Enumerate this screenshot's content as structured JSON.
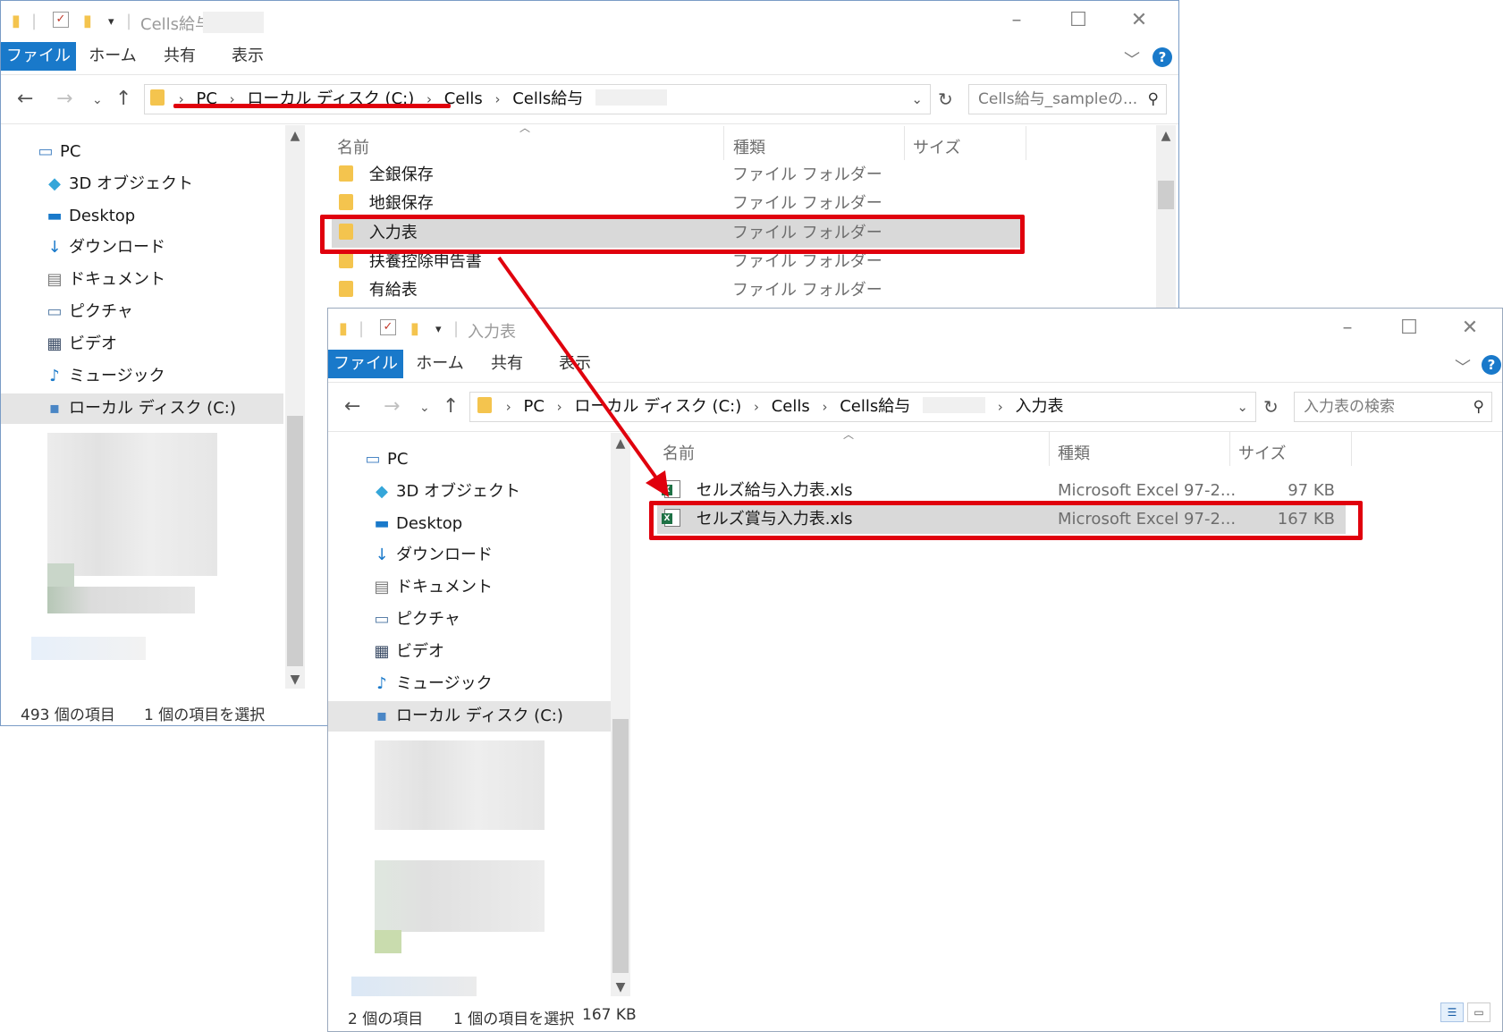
{
  "back_window": {
    "title": "Cells給与",
    "ribbon_tabs": [
      "ファイル",
      "ホーム",
      "共有",
      "表示"
    ],
    "breadcrumb": [
      "PC",
      "ローカル ディスク (C:)",
      "Cells",
      "Cells給与"
    ],
    "search_placeholder": "Cells給与_sampleの...",
    "columns": {
      "name": "名前",
      "type": "種類",
      "size": "サイズ"
    },
    "nav_items": [
      {
        "label": "PC",
        "icon": "pc-icon"
      },
      {
        "label": "3D オブジェクト",
        "icon": "3d-objects-icon"
      },
      {
        "label": "Desktop",
        "icon": "desktop-icon"
      },
      {
        "label": "ダウンロード",
        "icon": "download-icon"
      },
      {
        "label": "ドキュメント",
        "icon": "document-icon"
      },
      {
        "label": "ピクチャ",
        "icon": "picture-icon"
      },
      {
        "label": "ビデオ",
        "icon": "video-icon"
      },
      {
        "label": "ミュージック",
        "icon": "music-icon"
      },
      {
        "label": "ローカル ディスク (C:)",
        "icon": "local-disk-icon"
      }
    ],
    "files": [
      {
        "name": "全銀保存",
        "type": "ファイル フォルダー"
      },
      {
        "name": "地銀保存",
        "type": "ファイル フォルダー"
      },
      {
        "name": "入力表",
        "type": "ファイル フォルダー",
        "selected": true
      },
      {
        "name": "扶養控除申告書",
        "type": "ファイル フォルダー"
      },
      {
        "name": "有給表",
        "type": "ファイル フォルダー"
      }
    ],
    "status": {
      "count": "493 個の項目",
      "selected": "1 個の項目を選択"
    }
  },
  "front_window": {
    "title": "入力表",
    "ribbon_tabs": [
      "ファイル",
      "ホーム",
      "共有",
      "表示"
    ],
    "breadcrumb": [
      "PC",
      "ローカル ディスク (C:)",
      "Cells",
      "Cells給与",
      "入力表"
    ],
    "search_placeholder": "入力表の検索",
    "columns": {
      "name": "名前",
      "type": "種類",
      "size": "サイズ"
    },
    "nav_items": [
      {
        "label": "PC",
        "icon": "pc-icon"
      },
      {
        "label": "3D オブジェクト",
        "icon": "3d-objects-icon"
      },
      {
        "label": "Desktop",
        "icon": "desktop-icon"
      },
      {
        "label": "ダウンロード",
        "icon": "download-icon"
      },
      {
        "label": "ドキュメント",
        "icon": "document-icon"
      },
      {
        "label": "ピクチャ",
        "icon": "picture-icon"
      },
      {
        "label": "ビデオ",
        "icon": "video-icon"
      },
      {
        "label": "ミュージック",
        "icon": "music-icon"
      },
      {
        "label": "ローカル ディスク (C:)",
        "icon": "local-disk-icon"
      }
    ],
    "files": [
      {
        "name": "セルズ給与入力表.xls",
        "type": "Microsoft Excel 97-2...",
        "size": "97 KB"
      },
      {
        "name": "セルズ賞与入力表.xls",
        "type": "Microsoft Excel 97-2...",
        "size": "167 KB",
        "selected": true
      }
    ],
    "status": {
      "count": "2 個の項目",
      "selected": "1 個の項目を選択",
      "size": "167 KB"
    }
  },
  "colors": {
    "accent": "#1979ca",
    "highlight": "#e0000d",
    "selection": "#d9d9d9"
  }
}
